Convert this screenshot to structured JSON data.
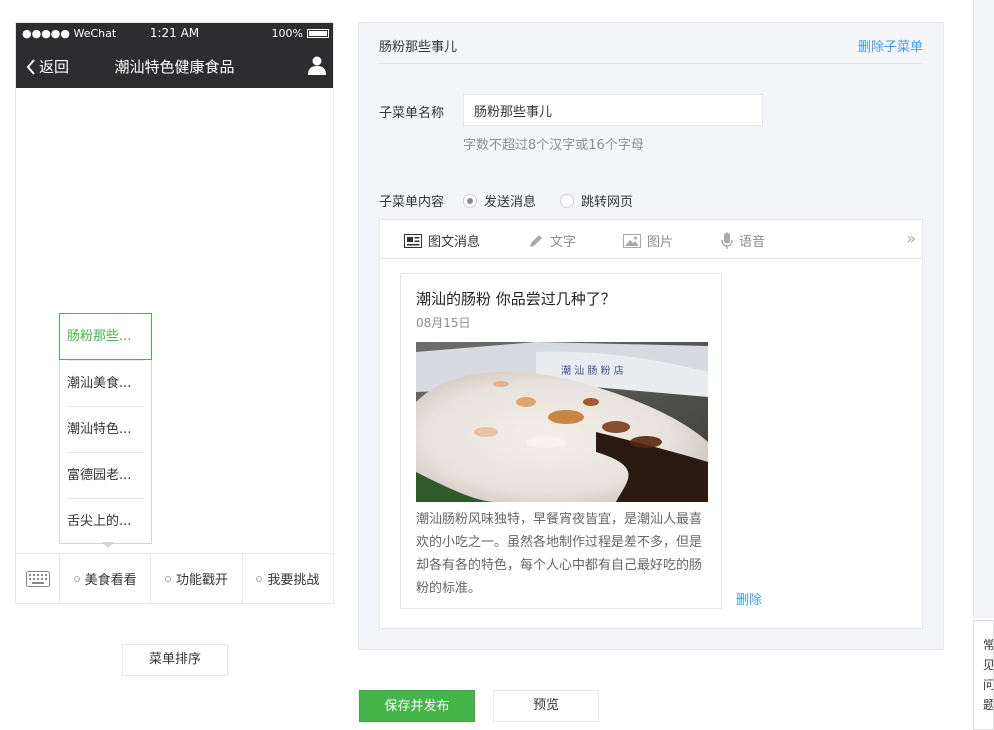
{
  "phone": {
    "carrier": "●●●●● WeChat",
    "time": "1:21 AM",
    "battery": "100%",
    "back": "返回",
    "title": "潮汕特色健康食品",
    "submenu": [
      "肠粉那些...",
      "潮汕美食...",
      "潮汕特色...",
      "富德园老...",
      "舌尖上的..."
    ],
    "menu": [
      "美食看看",
      "功能戳开",
      "我要挑战"
    ],
    "sort_button": "菜单排序"
  },
  "editor": {
    "title": "肠粉那些事儿",
    "delete_submenu": "删除子菜单",
    "name_label": "子菜单名称",
    "name_value": "肠粉那些事儿",
    "name_hint": "字数不超过8个汉字或16个字母",
    "content_label": "子菜单内容",
    "radio_send": "发送消息",
    "radio_jump": "跳转网页",
    "tabs": [
      "图文消息",
      "文字",
      "图片",
      "语音"
    ],
    "card": {
      "title": "潮汕的肠粉 你品尝过几种了？",
      "date": "08月15日",
      "desc": "潮汕肠粉风味独特，早餐宵夜皆宜，是潮汕人最喜欢的小吃之一。虽然各地制作过程是差不多，但是却各有各的特色，每个人心中都有自己最好吃的肠粉的标准。"
    },
    "delete_link": "删除"
  },
  "actions": {
    "save_publish": "保存并发布",
    "preview": "预览"
  },
  "side_text": "常见问题",
  "colors": {
    "accent_green": "#44b549",
    "link_blue": "#459ae9",
    "dark_bar": "#2d2d2f"
  }
}
